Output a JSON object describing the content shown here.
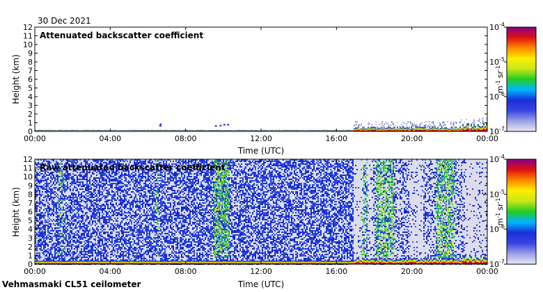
{
  "date": "30 Dec 2021",
  "footer": "Vehmasmaki CL51 ceilometer",
  "colors": {
    "background": "#ffffff",
    "noise_fill": "#dcdcec",
    "noise_blue": "#1a2fd9",
    "axis": "#000000"
  },
  "colorbar": {
    "ticks": [
      {
        "base": "10",
        "exp": "-4"
      },
      {
        "base": "10",
        "exp": "-5"
      },
      {
        "base": "10",
        "exp": "-6"
      },
      {
        "base": "10",
        "exp": "-7"
      }
    ],
    "unit": {
      "a": "m",
      "a_exp": "-1",
      "b": "sr",
      "b_exp": "-1"
    },
    "scale": "log",
    "range": [
      1e-07,
      0.0001
    ]
  },
  "chart_data": [
    {
      "type": "heatmap",
      "title": "Attenuated backscatter coefficient",
      "xlabel": "Time (UTC)",
      "ylabel": "Height (km)",
      "xlim": [
        "00:00",
        "24:00"
      ],
      "ylim": [
        0,
        12
      ],
      "x_ticks": [
        "00:00",
        "04:00",
        "08:00",
        "12:00",
        "16:00",
        "20:00",
        "00:00"
      ],
      "y_ticks": [
        "0",
        "1",
        "2",
        "3",
        "4",
        "5",
        "6",
        "7",
        "8",
        "9",
        "10",
        "11",
        "12"
      ],
      "grid": false,
      "features": [
        {
          "desc": "thin signal layer near surface",
          "t_start": 0,
          "t_end": 24,
          "h_top_km": 0.15
        },
        {
          "desc": "weak returns",
          "t_hour": 6.6,
          "h_km": 0.8
        },
        {
          "desc": "weak returns",
          "t_hour": 9.8,
          "h_km": 0.8
        },
        {
          "desc": "low cloud / aerosol layer",
          "t_start": 16.9,
          "t_end": 24,
          "h_top_km": 1.2
        },
        {
          "desc": "low layer increase",
          "t_start": 22.6,
          "t_end": 24,
          "h_top_km": 1.6
        }
      ]
    },
    {
      "type": "heatmap",
      "title": "Raw attenuated backscatter coefficient",
      "xlabel": "Time (UTC)",
      "ylabel": "Height (km)",
      "xlim": [
        "00:00",
        "24:00"
      ],
      "ylim": [
        0,
        12
      ],
      "x_ticks": [
        "00:00",
        "04:00",
        "08:00",
        "12:00",
        "16:00",
        "20:00",
        "00:00"
      ],
      "y_ticks": [
        "0",
        "1",
        "2",
        "3",
        "4",
        "5",
        "6",
        "7",
        "8",
        "9",
        "10",
        "11",
        "12"
      ],
      "grid": false,
      "features": [
        {
          "desc": "background noise speckle",
          "t_start": 0,
          "t_end": 24,
          "h_top_km": 12
        },
        {
          "desc": "high signal columns",
          "t_start": 9.5,
          "t_end": 10.3
        },
        {
          "desc": "high signal columns",
          "t_start": 18.1,
          "t_end": 19.0
        },
        {
          "desc": "high signal columns",
          "t_start": 21.3,
          "t_end": 22.2
        },
        {
          "desc": "weaker signal columns",
          "t_start": 1.2,
          "t_end": 1.5
        },
        {
          "desc": "washed out band",
          "t_start": 19.8,
          "t_end": 20.6
        },
        {
          "desc": "low dense layer",
          "t_start": 16.9,
          "t_end": 24,
          "h_top_km": 1.2
        }
      ]
    }
  ]
}
